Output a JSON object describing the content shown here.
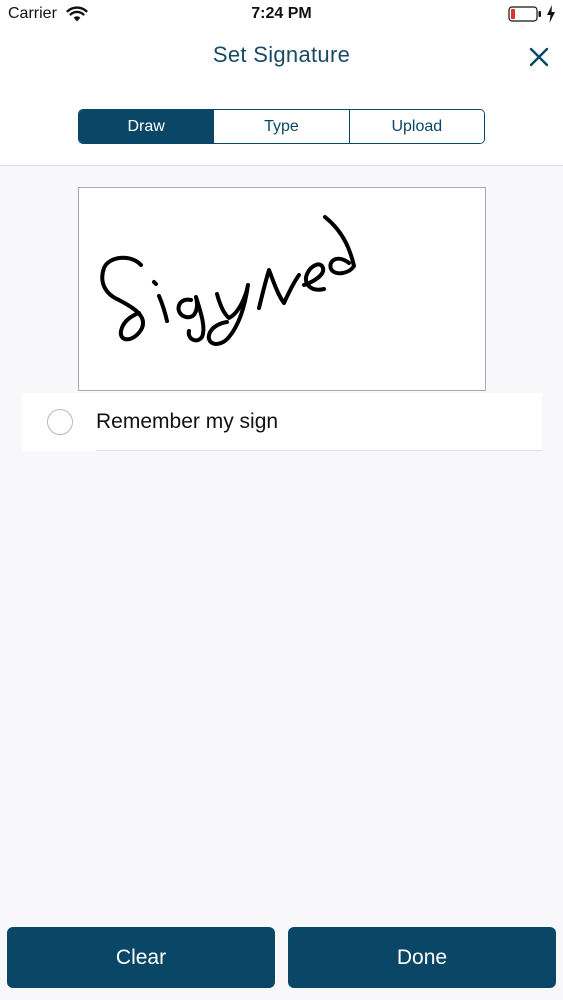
{
  "status_bar": {
    "carrier": "Carrier",
    "time": "7:24 PM",
    "icons": [
      "wifi-icon",
      "battery-low-icon",
      "charging-bolt-icon"
    ]
  },
  "header": {
    "title": "Set Signature",
    "close_icon": "close-icon"
  },
  "tabs": [
    {
      "label": "Draw",
      "active": true
    },
    {
      "label": "Type",
      "active": false
    },
    {
      "label": "Upload",
      "active": false
    }
  ],
  "options": {
    "remember_label": "Remember my sign",
    "remember_checked": false
  },
  "footer": {
    "clear_label": "Clear",
    "done_label": "Done"
  },
  "colors": {
    "primary": "#0a4766",
    "title": "#1a4a63",
    "background": "#f8f7fa",
    "battery_low": "#e0312f"
  }
}
